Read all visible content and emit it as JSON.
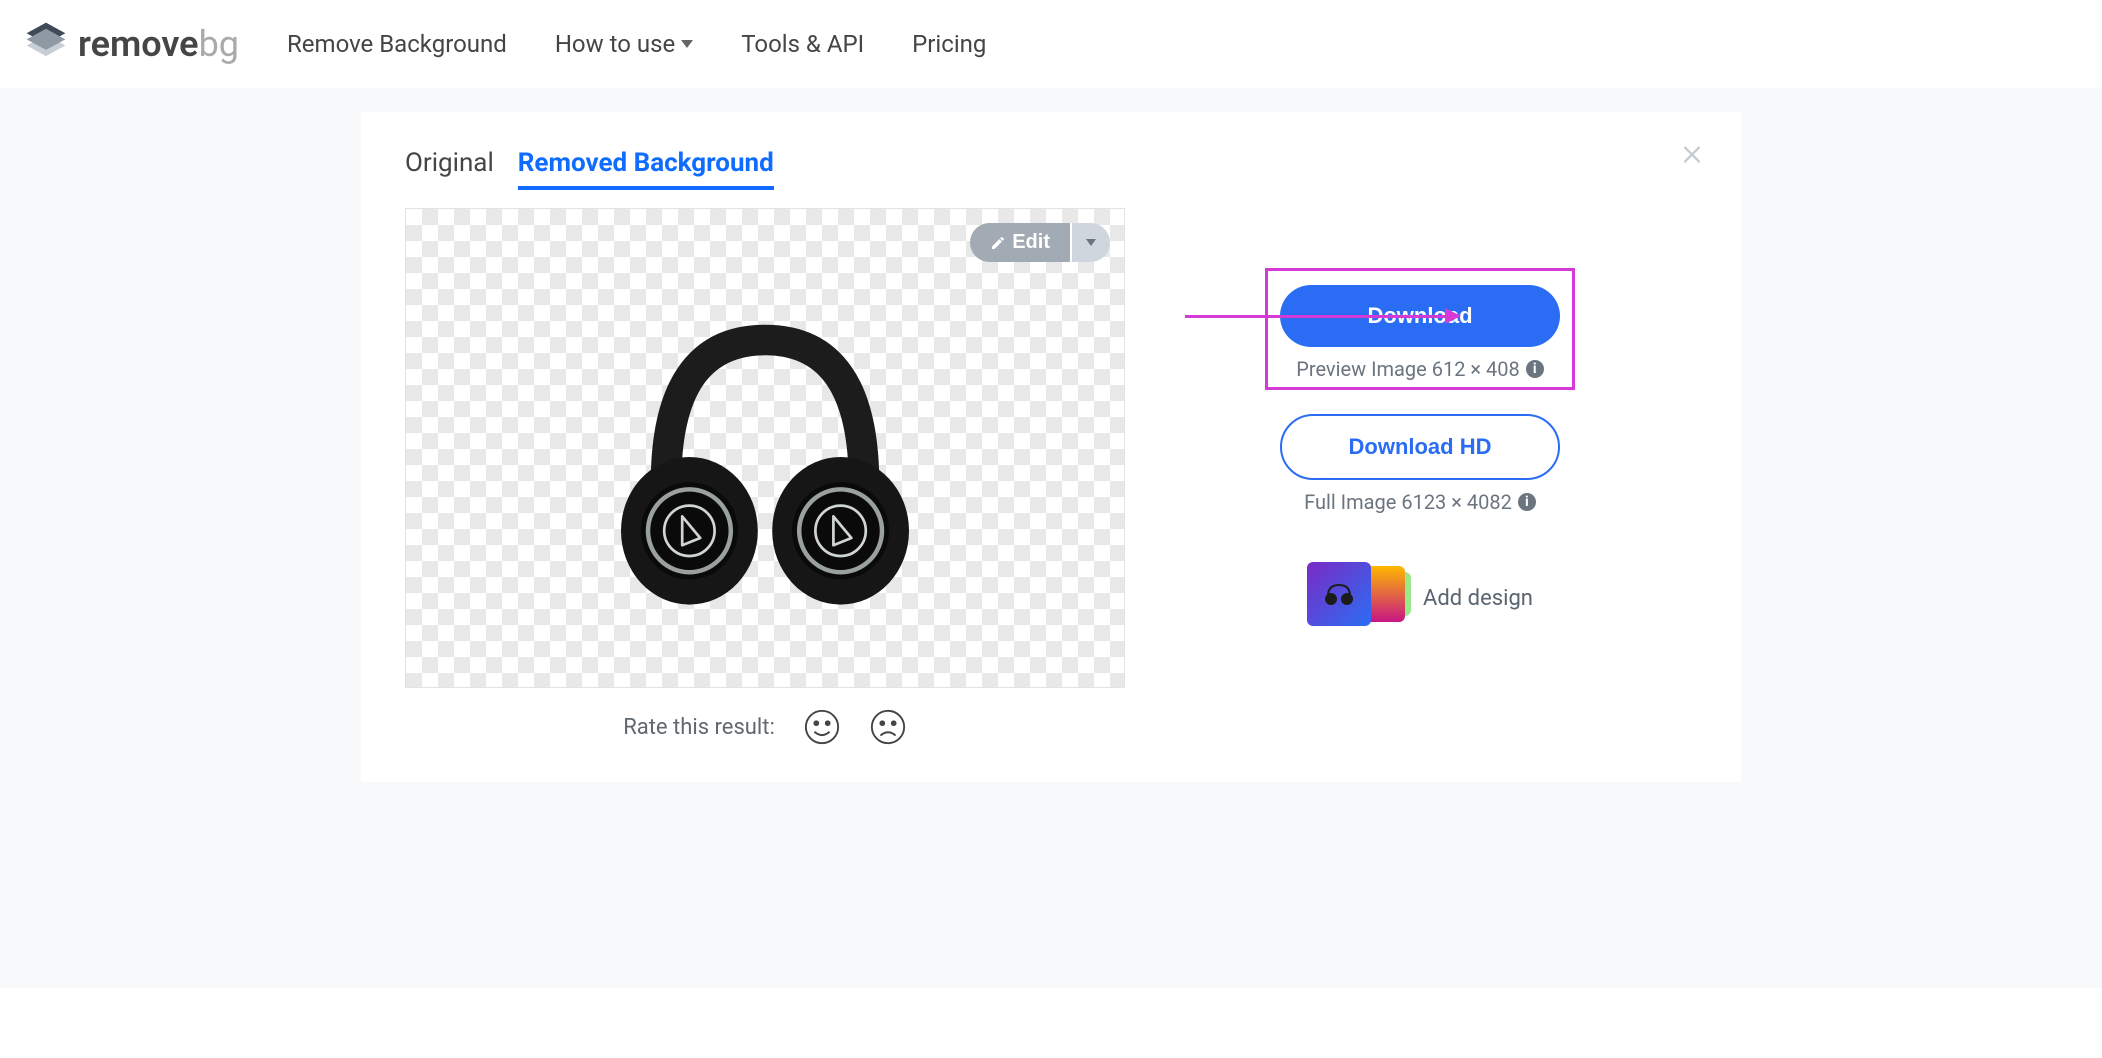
{
  "header": {
    "logo_text1": "remove",
    "logo_text2": "bg",
    "nav": {
      "remove_bg": "Remove Background",
      "how_to_use": "How to use",
      "tools_api": "Tools & API",
      "pricing": "Pricing"
    }
  },
  "tabs": {
    "original": "Original",
    "removed_bg": "Removed Background"
  },
  "edit": {
    "label": "Edit"
  },
  "rate": {
    "label": "Rate this result:"
  },
  "side": {
    "download": "Download",
    "preview_image": "Preview Image 612 × 408",
    "download_hd": "Download HD",
    "full_image": "Full Image 6123 × 4082",
    "add_design": "Add design"
  }
}
